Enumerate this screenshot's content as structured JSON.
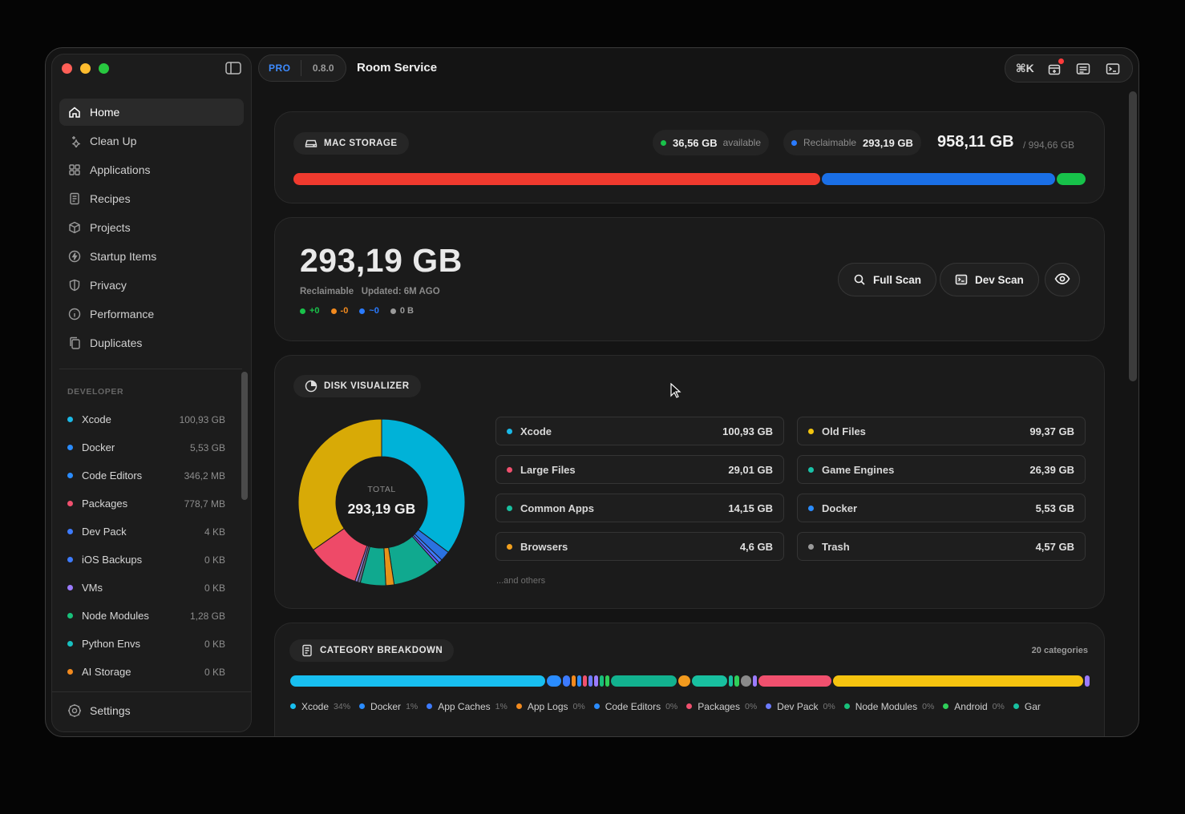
{
  "app": {
    "title": "Room Service",
    "badge": "PRO",
    "version": "0.8.0"
  },
  "toolbar": {
    "cmdk": "⌘K"
  },
  "sidebar": {
    "nav": [
      {
        "label": "Home",
        "icon": "home-icon"
      },
      {
        "label": "Clean Up",
        "icon": "sparkle-icon"
      },
      {
        "label": "Applications",
        "icon": "grid-icon"
      },
      {
        "label": "Recipes",
        "icon": "document-icon"
      },
      {
        "label": "Projects",
        "icon": "cube-icon"
      },
      {
        "label": "Startup Items",
        "icon": "bolt-icon"
      },
      {
        "label": "Privacy",
        "icon": "shield-icon"
      },
      {
        "label": "Performance",
        "icon": "info-icon"
      },
      {
        "label": "Duplicates",
        "icon": "copy-icon"
      }
    ],
    "developer_title": "DEVELOPER",
    "developer": [
      {
        "name": "Xcode",
        "size": "100,93 GB",
        "color": "#1ab8e6"
      },
      {
        "name": "Docker",
        "size": "5,53 GB",
        "color": "#2a8cff"
      },
      {
        "name": "Code Editors",
        "size": "346,2 MB",
        "color": "#2a8cff"
      },
      {
        "name": "Packages",
        "size": "778,7 MB",
        "color": "#f0506e"
      },
      {
        "name": "Dev Pack",
        "size": "4 KB",
        "color": "#3d7bff"
      },
      {
        "name": "iOS Backups",
        "size": "0 KB",
        "color": "#3d7bff"
      },
      {
        "name": "VMs",
        "size": "0 KB",
        "color": "#9b7bff"
      },
      {
        "name": "Node Modules",
        "size": "1,28 GB",
        "color": "#18c07a"
      },
      {
        "name": "Python Envs",
        "size": "0 KB",
        "color": "#18c0c0"
      },
      {
        "name": "AI Storage",
        "size": "0 KB",
        "color": "#f28a1e"
      }
    ],
    "settings": "Settings"
  },
  "storage": {
    "title": "MAC STORAGE",
    "available_value": "36,56 GB",
    "available_label": "available",
    "reclaimable_label": "Reclaimable",
    "reclaimable_value": "293,19 GB",
    "used": "958,11 GB",
    "total": "/ 994,66 GB",
    "bar": [
      {
        "name": "used",
        "fraction": 0.667,
        "color": "#f03a2e"
      },
      {
        "name": "reclaimable",
        "fraction": 0.295,
        "color": "#1a6fe6"
      },
      {
        "name": "available",
        "fraction": 0.037,
        "color": "#17c24a"
      }
    ]
  },
  "reclaim": {
    "amount": "293,19 GB",
    "label": "Reclaimable",
    "updated": "Updated: 6M AGO",
    "deltas": [
      {
        "text": "+0",
        "color": "#19c24a"
      },
      {
        "text": "-0",
        "color": "#f28a1e"
      },
      {
        "text": "~0",
        "color": "#2a7bff"
      },
      {
        "text": "0 B",
        "color": "#9a9a9a"
      }
    ],
    "full_scan": "Full Scan",
    "dev_scan": "Dev Scan"
  },
  "visualizer": {
    "title": "DISK VISUALIZER",
    "total_label": "TOTAL",
    "total_value": "293,19 GB",
    "items": [
      {
        "name": "Xcode",
        "size": "100,93 GB",
        "color": "#1ab8e6"
      },
      {
        "name": "Old Files",
        "size": "99,37 GB",
        "color": "#f2c40f"
      },
      {
        "name": "Large Files",
        "size": "29,01 GB",
        "color": "#f0506e"
      },
      {
        "name": "Game Engines",
        "size": "26,39 GB",
        "color": "#19c2a8"
      },
      {
        "name": "Common Apps",
        "size": "14,15 GB",
        "color": "#18c0a0"
      },
      {
        "name": "Docker",
        "size": "5,53 GB",
        "color": "#2a8cff"
      },
      {
        "name": "Browsers",
        "size": "4,6 GB",
        "color": "#f2a01e"
      },
      {
        "name": "Trash",
        "size": "4,57 GB",
        "color": "#9a9a9a"
      }
    ],
    "others": "...and others",
    "donut": [
      {
        "value": 100.93,
        "color": "#00b2d8"
      },
      {
        "value": 5.53,
        "color": "#2a72e0"
      },
      {
        "value": 2.0,
        "color": "#3d7bff"
      },
      {
        "value": 1.5,
        "color": "#6a5cff"
      },
      {
        "value": 26.39,
        "color": "#10a98f"
      },
      {
        "value": 4.6,
        "color": "#e6931a"
      },
      {
        "value": 14.15,
        "color": "#10a98f"
      },
      {
        "value": 1.5,
        "color": "#6d6d8a"
      },
      {
        "value": 1.5,
        "color": "#8a7ad8"
      },
      {
        "value": 29.01,
        "color": "#ee4a68"
      },
      {
        "value": 99.37,
        "color": "#d8aa06"
      }
    ]
  },
  "categories": {
    "title": "CATEGORY BREAKDOWN",
    "count": "20 categories",
    "bar": [
      {
        "fraction": 0.322,
        "color": "#18bff0"
      },
      {
        "fraction": 0.019,
        "color": "#2a8cff"
      },
      {
        "fraction": 0.009,
        "color": "#3d7bff"
      },
      {
        "fraction": 0.005,
        "color": "#f28a1e"
      },
      {
        "fraction": 0.005,
        "color": "#2a8cff"
      },
      {
        "fraction": 0.005,
        "color": "#f0506e"
      },
      {
        "fraction": 0.005,
        "color": "#6c7bff"
      },
      {
        "fraction": 0.005,
        "color": "#9b7bff"
      },
      {
        "fraction": 0.005,
        "color": "#18c07a"
      },
      {
        "fraction": 0.005,
        "color": "#2fcf5a"
      },
      {
        "fraction": 0.083,
        "color": "#12b28f"
      },
      {
        "fraction": 0.015,
        "color": "#f29a1e"
      },
      {
        "fraction": 0.045,
        "color": "#18c0a0"
      },
      {
        "fraction": 0.005,
        "color": "#18c0a0"
      },
      {
        "fraction": 0.006,
        "color": "#2fcf5a"
      },
      {
        "fraction": 0.013,
        "color": "#8a8a8a"
      },
      {
        "fraction": 0.005,
        "color": "#9b7bff"
      },
      {
        "fraction": 0.092,
        "color": "#f0506e"
      },
      {
        "fraction": 0.316,
        "color": "#f5c30f"
      },
      {
        "fraction": 0.006,
        "color": "#9b7bff"
      }
    ],
    "legend": [
      {
        "name": "Xcode",
        "pct": "34%",
        "color": "#18bff0"
      },
      {
        "name": "Docker",
        "pct": "1%",
        "color": "#2a8cff"
      },
      {
        "name": "App Caches",
        "pct": "1%",
        "color": "#3d7bff"
      },
      {
        "name": "App Logs",
        "pct": "0%",
        "color": "#f28a1e"
      },
      {
        "name": "Code Editors",
        "pct": "0%",
        "color": "#2a8cff"
      },
      {
        "name": "Packages",
        "pct": "0%",
        "color": "#f0506e"
      },
      {
        "name": "Dev Pack",
        "pct": "0%",
        "color": "#6c7bff"
      },
      {
        "name": "Node Modules",
        "pct": "0%",
        "color": "#18c07a"
      },
      {
        "name": "Android",
        "pct": "0%",
        "color": "#2fcf5a"
      },
      {
        "name": "Gar",
        "pct": "",
        "color": "#18c0a0"
      }
    ]
  }
}
